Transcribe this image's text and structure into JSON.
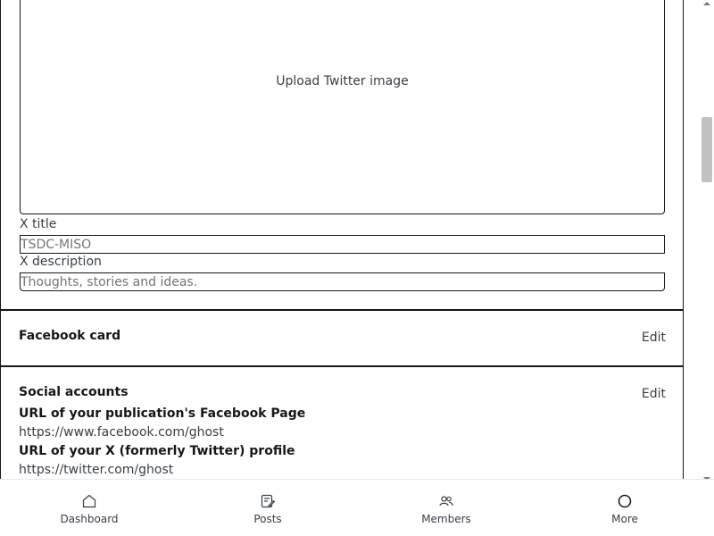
{
  "twitter_card": {
    "upload_label": "Upload Twitter image",
    "title_label": "X title",
    "title_placeholder": "TSDC-MISO",
    "description_label": "X description",
    "description_placeholder": "Thoughts, stories and ideas."
  },
  "facebook_card": {
    "title": "Facebook card",
    "edit_label": "Edit"
  },
  "social_accounts": {
    "title": "Social accounts",
    "edit_label": "Edit",
    "facebook_label": "URL of your publication's Facebook Page",
    "facebook_value": "https://www.facebook.com/ghost",
    "twitter_label": "URL of your X (formerly Twitter) profile",
    "twitter_value": "https://twitter.com/ghost"
  },
  "bottom_nav": {
    "items": [
      {
        "label": "Dashboard",
        "icon": "home-icon"
      },
      {
        "label": "Posts",
        "icon": "posts-icon"
      },
      {
        "label": "Members",
        "icon": "members-icon"
      },
      {
        "label": "More",
        "icon": "circle-icon"
      }
    ]
  },
  "colors": {
    "text_primary": "#15171a",
    "text_secondary": "#394047",
    "placeholder": "#abb4be",
    "scrollbar_thumb": "#c1c1c1"
  }
}
